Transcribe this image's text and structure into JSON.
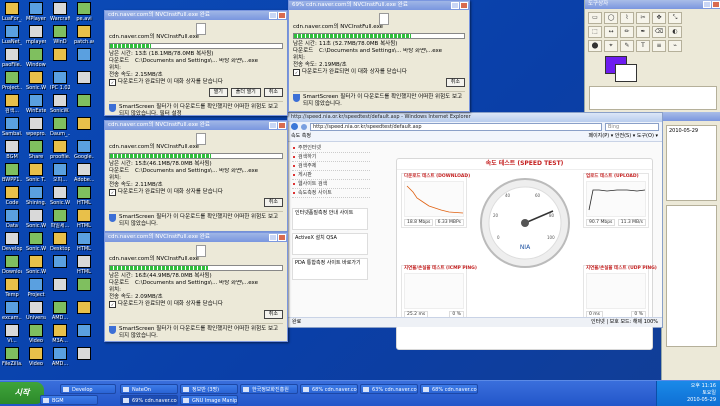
{
  "desktop": {
    "icons": [
      [
        "LuaFor_...",
        "MPlayer...",
        "Warcraft III",
        "pe.avi"
      ],
      [
        "LuaNet_...",
        "mplayer...",
        "WinD",
        "patch.avi"
      ],
      [
        "paoFile...",
        "Windows",
        "",
        ""
      ],
      [
        "Project...",
        "Sonic.W...",
        "IPC 1.02",
        ""
      ],
      [
        "검색...",
        "WinExte...",
        "SonicW...",
        ""
      ],
      [
        "SambaI...",
        "wpepro...",
        "Daum_...",
        ""
      ],
      [
        "BGM",
        "Share",
        "proofile...",
        "Google..."
      ],
      [
        "BWPP1...",
        "Sonic T...",
        "오피...",
        "Adobe..."
      ],
      [
        "Code",
        "Shining...",
        "Sonic.W...",
        "HTML"
      ],
      [
        "Data",
        "Sonic.W...",
        "파일세...",
        "HTML"
      ],
      [
        "Develop",
        "Sonic.W...",
        "Desktop",
        "HTML"
      ],
      [
        "Download",
        "Sonic.W...",
        "",
        "HTML"
      ],
      [
        "Temp",
        "Project",
        "",
        ""
      ],
      [
        "excam...",
        "Universal",
        "AMD...",
        ""
      ],
      [
        "Vi...",
        "Video",
        "M3A...",
        ""
      ],
      [
        "FileZilla...",
        "Video",
        "AMD...",
        ""
      ]
    ]
  },
  "dialogs": [
    {
      "title": "cdn.naver.com의 NVCInstFull.exe 완료",
      "file": "cdn.naver.com의 NVCInstFull.exe",
      "remain_label": "남은 시간:",
      "remain": "13초 (18.1MB/78.0MB 복사됨)",
      "dest_label": "다운로드 위치:",
      "dest": "C:\\Documents and Settings\\... 바탕 화면\\...exe",
      "speed_label": "전송 속도:",
      "speed": "2.15MB/초",
      "close_chk": "다운로드가 완료되면 이 대화 상자를 닫습니다",
      "open": "열기",
      "openfolder": "폴더 열기",
      "cancel": "취소",
      "warn": "SmartScreen 필터가 이 다운로드를 확인했지만 어떠한 위험도 보고되지 않았습니다. 필터 설정",
      "progress": 0.24
    },
    {
      "title": "69% cdn.naver.com의 NVCInstFull.exe 완료",
      "file": "cdn.naver.com의 NVCInstFull.exe",
      "remain_label": "남은 시간:",
      "remain": "11초 (52.7MB/78.0MB 복사됨)",
      "dest_label": "다운로드 위치:",
      "dest": "C:\\Documents and Settings\\... 바탕 화면\\...exe",
      "speed_label": "전송 속도:",
      "speed": "2.19MB/초",
      "close_chk": "다운로드가 완료되면 이 대화 상자를 닫습니다",
      "cancel": "취소",
      "warn": "SmartScreen 필터가 이 다운로드를 확인했지만 어떠한 위험도 보고되지 않았습니다.",
      "progress": 0.69
    },
    {
      "title": "cdn.naver.com의 NVCInstFull.exe 완료",
      "file": "cdn.naver.com의 NVCInstFull.exe",
      "remain_label": "남은 시간:",
      "remain": "15초(46.1MB/78.0MB 복사됨)",
      "dest_label": "다운로드 위치:",
      "dest": "C:\\Documents and Settings\\... 바탕 화면\\...exe",
      "speed_label": "전송 속도:",
      "speed": "2.11MB/초",
      "close_chk": "다운로드가 완료되면 이 대화 상자를 닫습니다",
      "cancel": "취소",
      "warn": "SmartScreen 필터가 이 다운로드를 확인했지만 어떠한 위험도 보고되지 않았습니다.",
      "progress": 0.59
    },
    {
      "title": "cdn.naver.com의 NVCInstFull.exe 완료",
      "file": "cdn.naver.com의 NVCInstFull.exe",
      "remain_label": "남은 시간:",
      "remain": "16초(44.9MB/78.0MB 복사됨)",
      "dest_label": "다운로드 위치:",
      "dest": "C:\\Documents and Settings\\... 바탕 화면\\...exe",
      "speed_label": "전송 속도:",
      "speed": "2.09MB/초",
      "close_chk": "다운로드가 완료되면 이 대화 상자를 닫습니다",
      "cancel": "취소",
      "warn": "SmartScreen 필터가 이 다운로드를 확인했지만 어떠한 위험도 보고되지 않았습니다.",
      "progress": 0.57
    }
  ],
  "browser": {
    "title": "http://speed.nia.or.kr/speedtest/default.asp - Windows Internet Explorer",
    "url": "http://speed.nia.or.kr/speedtest/default.asp",
    "search_placeholder": "Bing",
    "tab": "속도 측정",
    "cmd_right": "페이지(P) ▾   안전(S) ▾   도구(O) ▾",
    "menu": [
      "주변인터넷",
      "검색하기",
      "검색주제",
      "게시판",
      "웹사이트 검색",
      "속도측정 사이트"
    ],
    "ad1": "인터넷품질측정 안내 사이트",
    "ad2": "ActiveX 설치 QSA",
    "ad3": "PDA 통합측정 사이트 바로가기",
    "status_left": "완료",
    "status_right": "인터넷 | 보호 모드: 해제      100%",
    "speed": {
      "title": "속도 테스트 (SPEED TEST)",
      "download_title": "다운로드 테스트 (DOWNLOAD)",
      "upload_title": "업로드 테스트 (UPLOAD)",
      "icmp_title": "지연율/손실율 테스트 (ICMP PING)",
      "udp_title": "지연율/손실율 테스트 (UDP PING)",
      "download_vals": [
        "18.8 Mbps",
        "6.33 MBPs"
      ],
      "upload_vals": [
        "90.7 Mbps",
        "11.3 MB/s"
      ],
      "icmp_vals": [
        "25.2 ms",
        "0 %"
      ],
      "udp_vals": [
        "0 ms",
        "0 %"
      ],
      "gauge_label": "NIA",
      "gauge_ticks": [
        "0",
        "20",
        "40",
        "60",
        "80",
        "100"
      ]
    }
  },
  "gimp": {
    "title": "도구상자",
    "tools": [
      "▭",
      "◯",
      "⌇",
      "✂",
      "✥",
      "⤡",
      "⬚",
      "↔",
      "✏",
      "✒",
      "⌫",
      "◐",
      "⬤",
      "⌖",
      "✎",
      "T",
      "≡",
      "⌁"
    ]
  },
  "rightpanel": {
    "date1": "2010-05-29",
    "items": [
      "오후 11:16",
      "토요일",
      "2010-05-29"
    ]
  },
  "taskbar": {
    "start": "시작",
    "tasks": [
      "NateOn",
      "정보반 (3명)",
      "한국정보화진흥원",
      "68% cdn.naver.com",
      "63% cdn.naver.com",
      "68% cdn.naver.com",
      "BGM",
      "69% cdn.naver.com",
      "GNU Image Manip",
      "Develop"
    ],
    "time": "오후 11:16",
    "day": "토요일",
    "date": "2010-05-29"
  }
}
